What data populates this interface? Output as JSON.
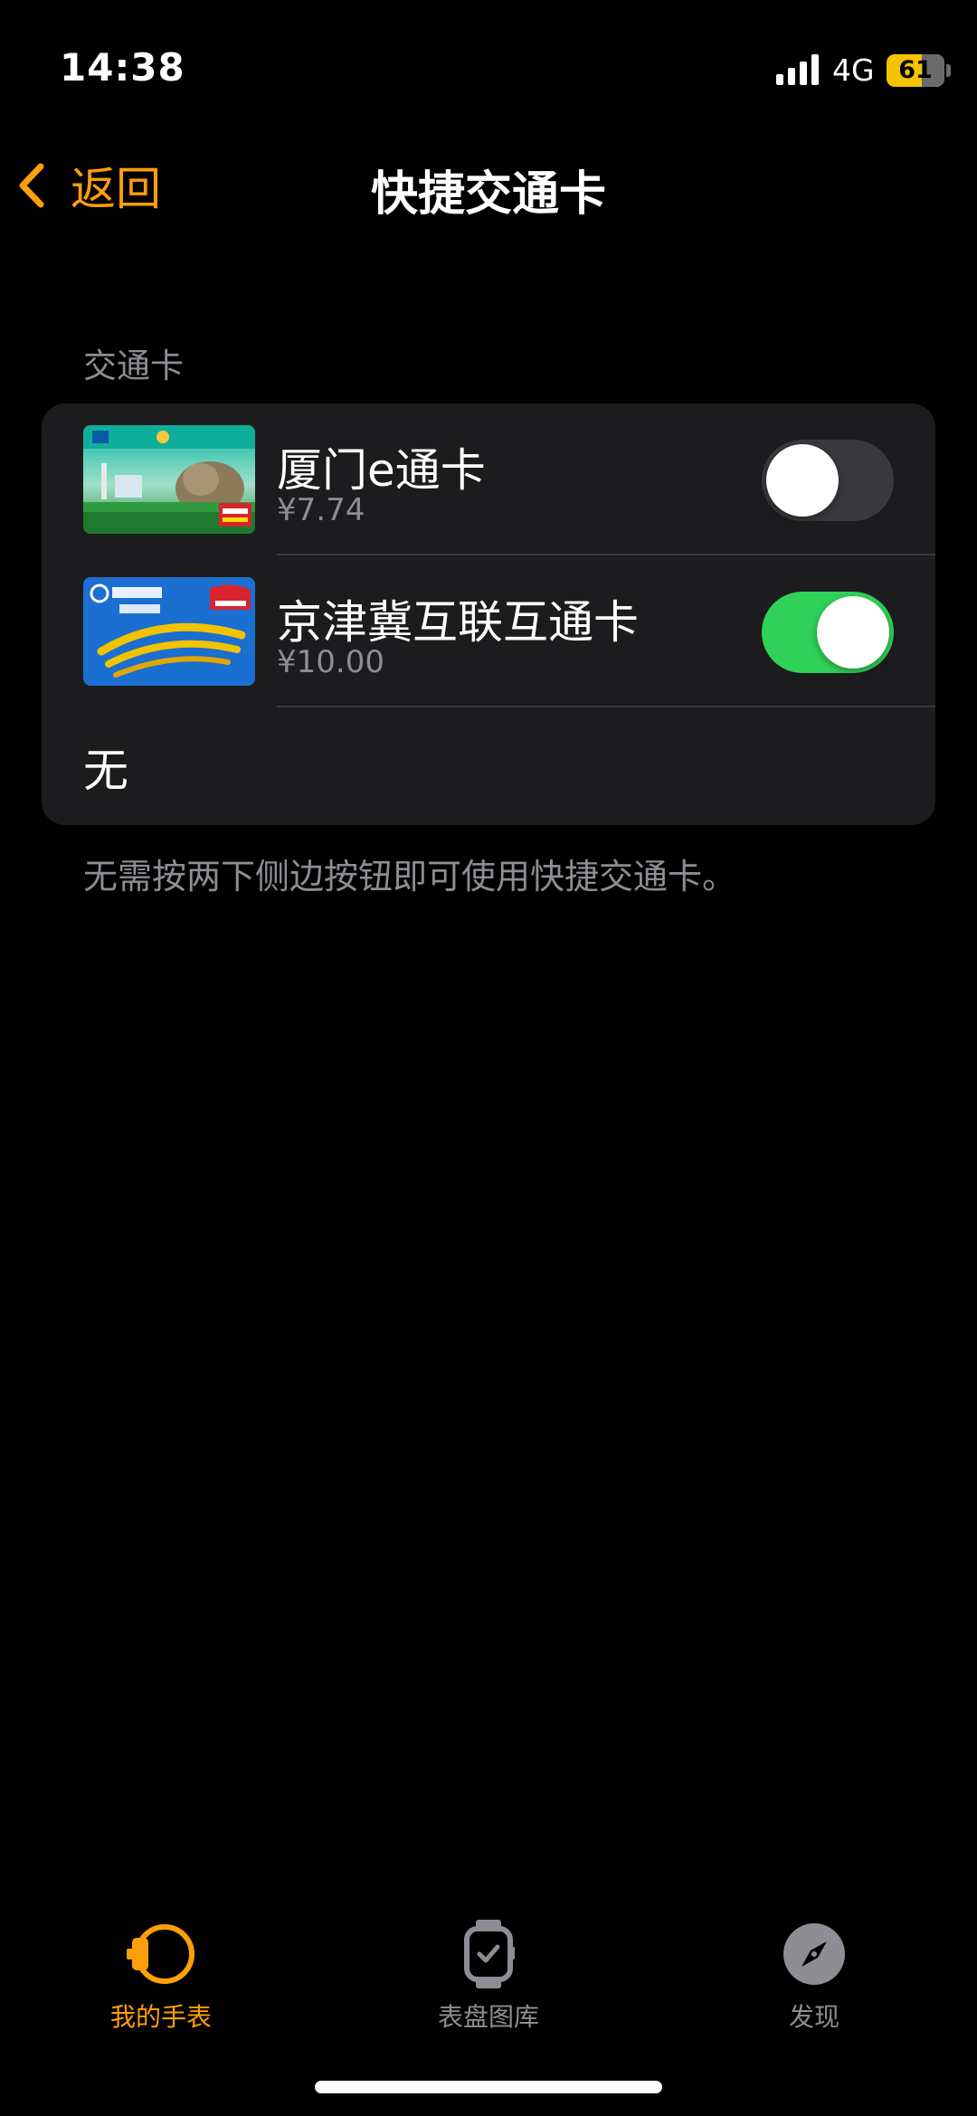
{
  "status_bar": {
    "time": "14:38",
    "network": "4G",
    "battery_percent": "61",
    "battery_level": 0.61,
    "battery_color": "#f5c400",
    "signal_icon": "signal-bars-icon"
  },
  "nav": {
    "back_label": "返回",
    "back_icon": "chevron-left-icon",
    "title": "快捷交通卡",
    "accent_color": "#ff9f0a"
  },
  "section": {
    "header": "交通卡",
    "cards": [
      {
        "name": "厦门e通卡",
        "balance": "¥7.74",
        "enabled": false,
        "thumb_icon": "xiamen-card-icon"
      },
      {
        "name": "京津冀互联互通卡",
        "balance": "¥10.00",
        "enabled": true,
        "thumb_icon": "beijing-card-icon"
      }
    ],
    "none_label": "无",
    "footer": "无需按两下侧边按钮即可使用快捷交通卡。"
  },
  "tab_bar": {
    "tabs": [
      {
        "label": "我的手表",
        "icon": "watch-side-icon",
        "active": true
      },
      {
        "label": "表盘图库",
        "icon": "watch-face-icon",
        "active": false
      },
      {
        "label": "发现",
        "icon": "compass-icon",
        "active": false
      }
    ],
    "active_color": "#ff9f0a",
    "inactive_color": "#8d8d93"
  },
  "colors": {
    "toggle_on": "#30d158",
    "toggle_off": "#39393d",
    "group_background": "#1c1c1e"
  }
}
